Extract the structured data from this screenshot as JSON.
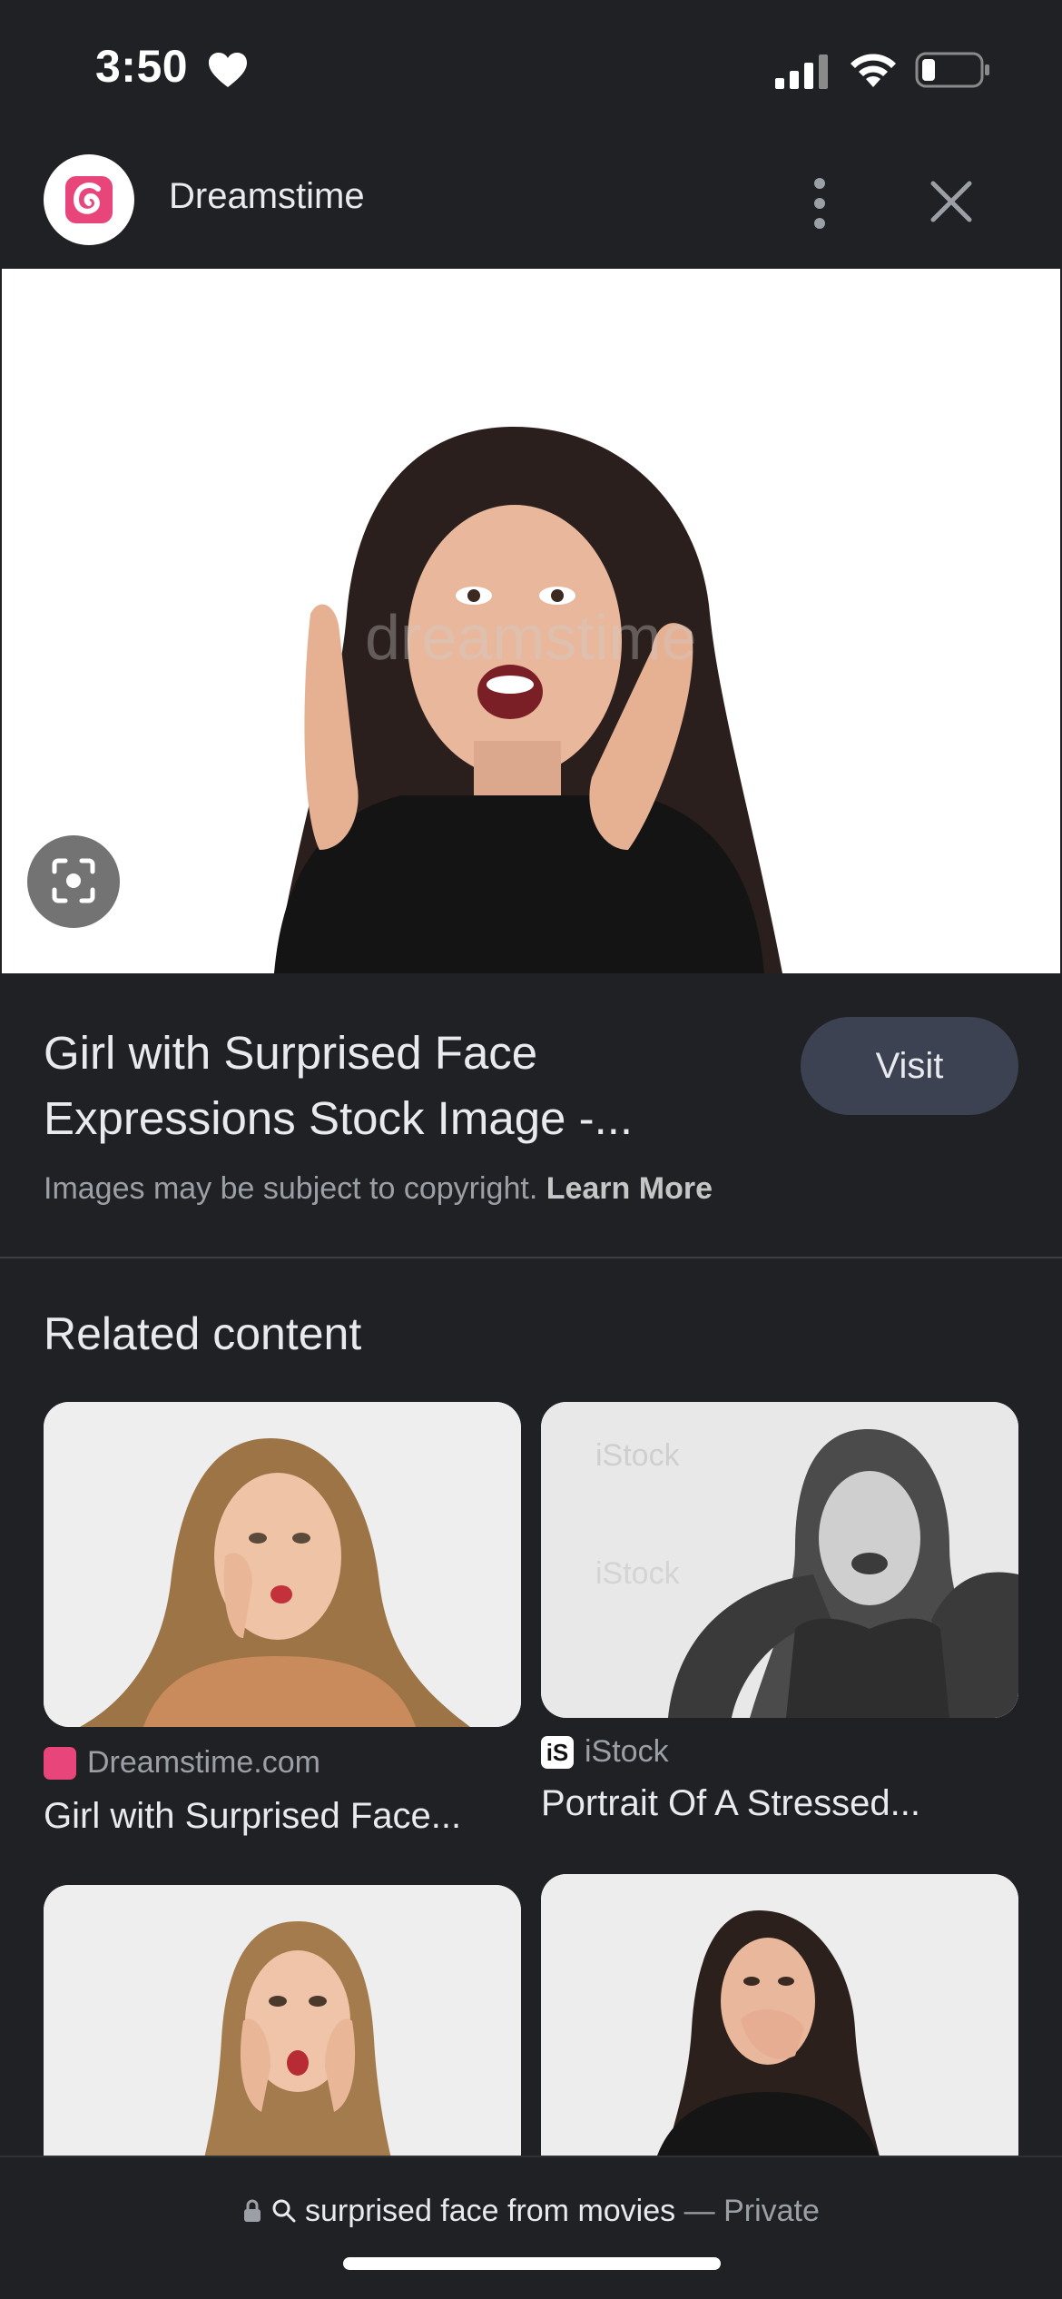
{
  "status_bar": {
    "time": "3:50",
    "icons": [
      "heart-icon",
      "signal-icon",
      "wifi-icon",
      "battery-icon"
    ]
  },
  "header": {
    "site_name": "Dreamstime",
    "logo_icon": "dreamstime-logo",
    "more_icon": "more-vert-icon",
    "close_icon": "close-icon"
  },
  "result": {
    "title": "Girl with Surprised Face Expressions Stock Image -...",
    "visit_label": "Visit",
    "copyright_text": "Images may be subject to copyright.",
    "learn_more_label": "Learn More",
    "lens_icon": "lens-search-icon"
  },
  "related": {
    "heading": "Related content",
    "items": [
      {
        "source": "Dreamstime.com",
        "source_icon": "dreamstime-icon",
        "title": "Girl with Surprised Face..."
      },
      {
        "source": "iStock",
        "source_icon": "istock-icon",
        "title": "Portrait Of A Stressed..."
      },
      {
        "source": "",
        "title": ""
      },
      {
        "source": "",
        "title": ""
      }
    ]
  },
  "address_bar": {
    "query": "surprised face from movies",
    "separator": "—",
    "mode": "Private",
    "icons": [
      "lock-icon",
      "search-icon"
    ]
  },
  "colors": {
    "background": "#202124",
    "visit_button": "#3c4252",
    "brand_pink": "#e8457a"
  }
}
